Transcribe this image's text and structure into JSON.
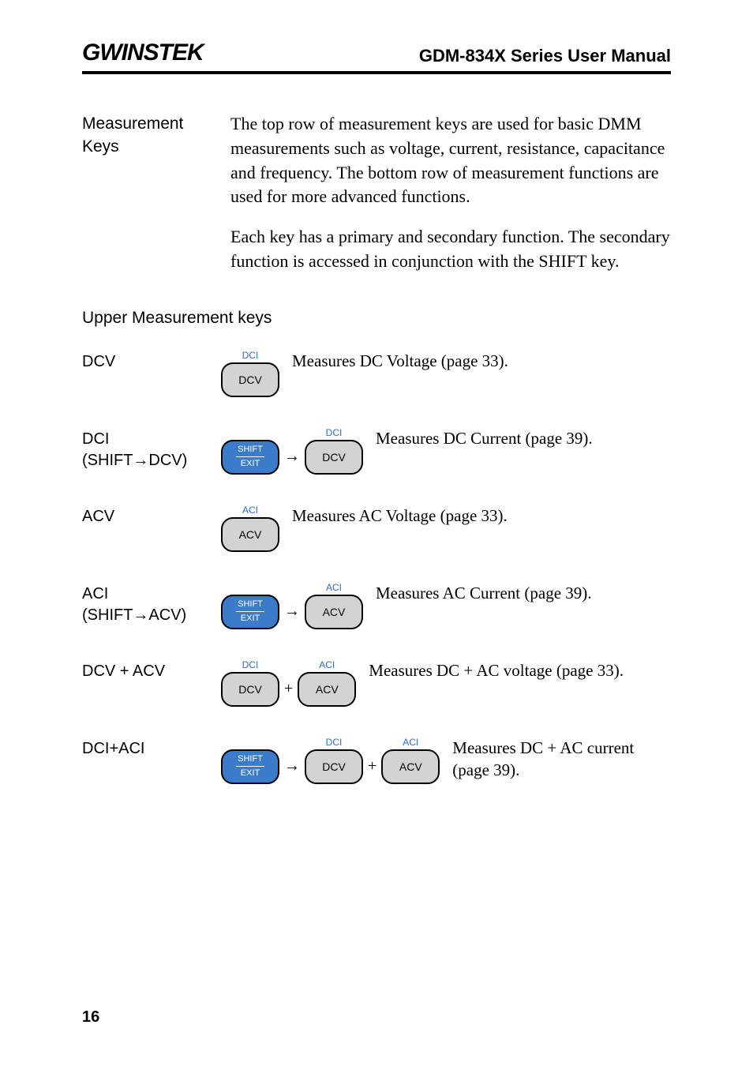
{
  "header": {
    "logo": "GWINSTEK",
    "manual_title": "GDM-834X Series User Manual"
  },
  "intro": {
    "label": "Measurement Keys",
    "para1": "The top row of measurement keys are used for basic DMM measurements such as voltage, current, resistance, capacitance and frequency. The bottom row of measurement functions are used for more advanced functions.",
    "para2": "Each key has a primary and secondary function. The secondary function is accessed in conjunction with the SHIFT key."
  },
  "section_heading": "Upper Measurement keys",
  "keys": {
    "dcv": {
      "label": "DCV",
      "top": "DCI",
      "main": "DCV",
      "desc": "Measures DC Voltage (page 33)."
    },
    "dci": {
      "label": "DCI (SHIFT→DCV)",
      "shift_top": "SHIFT",
      "shift_bot": "EXIT",
      "arrow": "→",
      "top": "DCI",
      "main": "DCV",
      "desc": "Measures DC Current (page 39)."
    },
    "acv": {
      "label": "ACV",
      "top": "ACI",
      "main": "ACV",
      "desc": "Measures AC Voltage (page 33)."
    },
    "aci": {
      "label": "ACI (SHIFT→ACV)",
      "shift_top": "SHIFT",
      "shift_bot": "EXIT",
      "arrow": "→",
      "top": "ACI",
      "main": "ACV",
      "desc": "Measures AC Current (page 39)."
    },
    "dcv_acv": {
      "label": "DCV + ACV",
      "top1": "DCI",
      "main1": "DCV",
      "plus": "+",
      "top2": "ACI",
      "main2": "ACV",
      "desc": "Measures DC + AC voltage (page 33)."
    },
    "dci_aci": {
      "label": "DCI+ACI",
      "shift_top": "SHIFT",
      "shift_bot": "EXIT",
      "arrow": "→",
      "top1": "DCI",
      "main1": "DCV",
      "plus": "+",
      "top2": "ACI",
      "main2": "ACV",
      "desc": "Measures DC + AC current (page 39)."
    }
  },
  "page_number": "16"
}
